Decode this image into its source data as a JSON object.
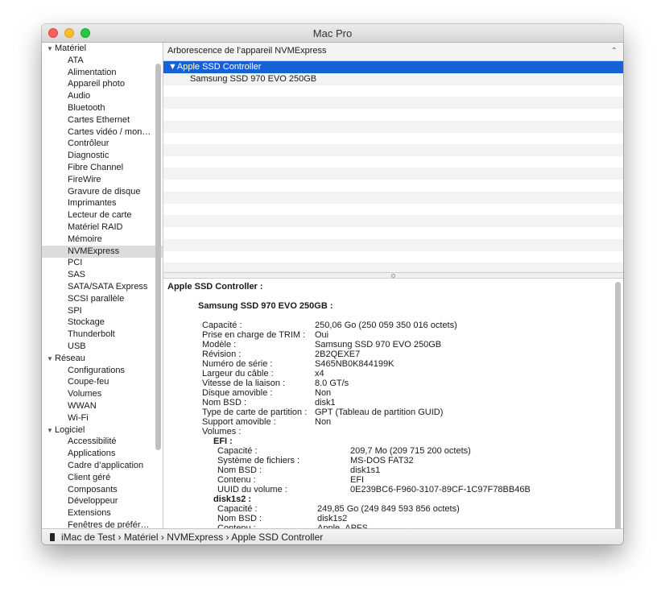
{
  "window": {
    "title": "Mac Pro"
  },
  "sidebar": {
    "sections": [
      {
        "label": "Matériel",
        "items": [
          "ATA",
          "Alimentation",
          "Appareil photo",
          "Audio",
          "Bluetooth",
          "Cartes Ethernet",
          "Cartes vidéo / mon…",
          "Contrôleur",
          "Diagnostic",
          "Fibre Channel",
          "FireWire",
          "Gravure de disque",
          "Imprimantes",
          "Lecteur de carte",
          "Matériel RAID",
          "Mémoire",
          "NVMExpress",
          "PCI",
          "SAS",
          "SATA/SATA Express",
          "SCSI parallèle",
          "SPI",
          "Stockage",
          "Thunderbolt",
          "USB"
        ]
      },
      {
        "label": "Réseau",
        "items": [
          "Configurations",
          "Coupe-feu",
          "Volumes",
          "WWAN",
          "Wi-Fi"
        ]
      },
      {
        "label": "Logiciel",
        "items": [
          "Accessibilité",
          "Applications",
          "Cadre d’application",
          "Client géré",
          "Composants",
          "Développeur",
          "Extensions",
          "Fenêtres de préfér…"
        ]
      }
    ],
    "selected": "NVMExpress"
  },
  "tree": {
    "header": "Arborescence de l’appareil NVMExpress",
    "rows": [
      "▼Apple SSD Controller",
      "Samsung SSD 970 EVO 250GB"
    ]
  },
  "detail": {
    "controller_title": "Apple SSD Controller :",
    "device_title": "Samsung SSD 970 EVO 250GB :",
    "properties": [
      {
        "label": "Capacité :",
        "value": "250,06 Go (250 059 350 016 octets)"
      },
      {
        "label": "Prise en charge de TRIM :",
        "value": "Oui"
      },
      {
        "label": "Modèle :",
        "value": "Samsung SSD 970 EVO 250GB"
      },
      {
        "label": "Révision :",
        "value": "2B2QEXE7"
      },
      {
        "label": "Numéro de série :",
        "value": "S465NB0K844199K"
      },
      {
        "label": "Largeur du câble :",
        "value": "x4"
      },
      {
        "label": "Vitesse de la liaison :",
        "value": "8.0 GT/s"
      },
      {
        "label": "Disque amovible :",
        "value": "Non"
      },
      {
        "label": "Nom BSD :",
        "value": "disk1"
      },
      {
        "label": "Type de carte de partition :",
        "value": "GPT (Tableau de partition GUID)"
      },
      {
        "label": "Support amovible :",
        "value": "Non"
      }
    ],
    "volumes_label": "Volumes :",
    "volumes": [
      {
        "name": "EFI :",
        "fields": [
          {
            "label": "Capacité :",
            "value": "209,7 Mo (209 715 200 octets)"
          },
          {
            "label": "Système de fichiers :",
            "value": "MS-DOS FAT32"
          },
          {
            "label": "Nom BSD :",
            "value": "disk1s1"
          },
          {
            "label": "Contenu :",
            "value": "EFI"
          },
          {
            "label": "UUID du volume :",
            "value": "0E239BC6-F960-3107-89CF-1C97F78BB46B"
          }
        ]
      },
      {
        "name": "disk1s2 :",
        "fields": [
          {
            "label": "Capacité :",
            "value": "249,85 Go (249 849 593 856 octets)"
          },
          {
            "label": "Nom BSD :",
            "value": "disk1s2"
          },
          {
            "label": "Contenu :",
            "value": "Apple_APFS"
          }
        ]
      }
    ]
  },
  "pathbar": {
    "path": [
      "iMac de Test",
      "Matériel",
      "NVMExpress",
      "Apple SSD Controller"
    ],
    "separator": "›"
  },
  "icons": {
    "computer": "mac-pro-icon",
    "disclosure": "disclosure-triangle-icon",
    "sort": "sort-caret-icon"
  },
  "colors": {
    "selection": "#1660d8",
    "sidebar_selection": "#dcdcdc"
  }
}
